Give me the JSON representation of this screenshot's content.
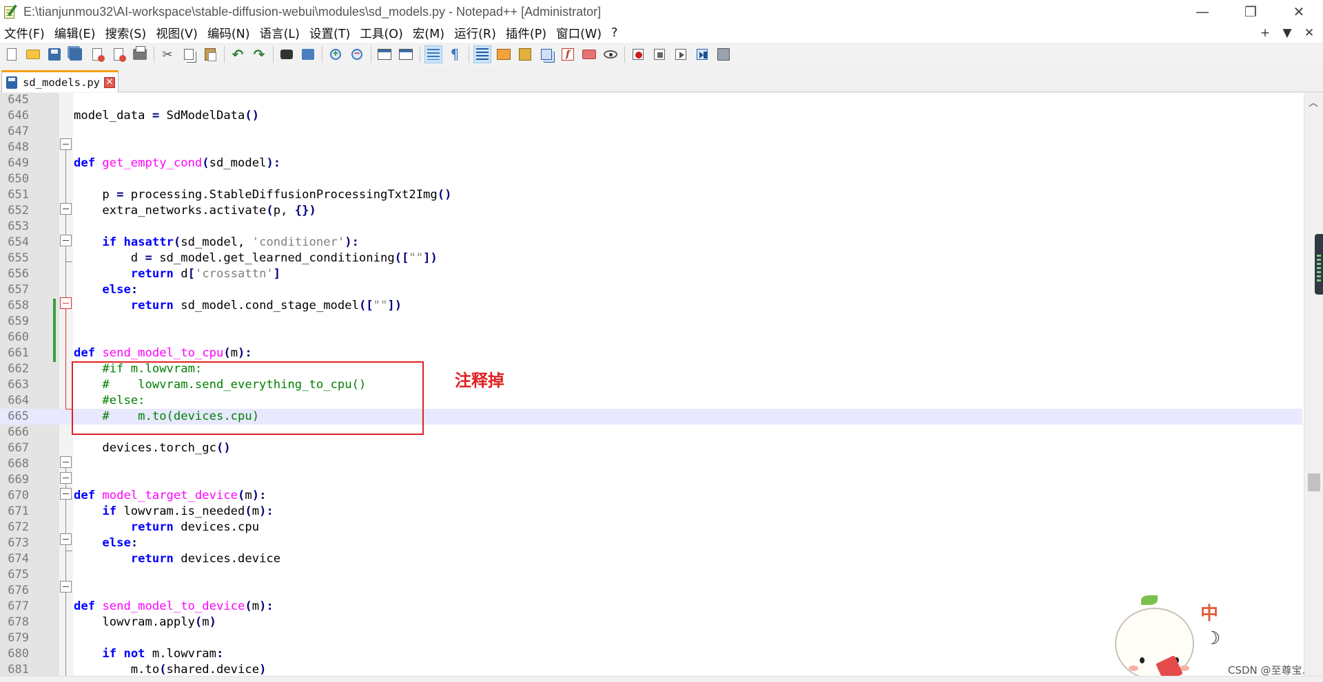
{
  "window": {
    "title": "E:\\tianjunmou32\\AI-workspace\\stable-diffusion-webui\\modules\\sd_models.py - Notepad++ [Administrator]",
    "controls": {
      "minimize": "—",
      "restore": "❐",
      "close": "✕"
    }
  },
  "menu": {
    "items": [
      "文件(F)",
      "编辑(E)",
      "搜索(S)",
      "视图(V)",
      "编码(N)",
      "语言(L)",
      "设置(T)",
      "工具(O)",
      "宏(M)",
      "运行(R)",
      "插件(P)",
      "窗口(W)",
      "?"
    ],
    "right": [
      "+",
      "▼",
      "✕"
    ]
  },
  "toolbar": {
    "icons": [
      "new-file-icon",
      "open-file-icon",
      "save-icon",
      "save-all-icon",
      "close-icon",
      "close-all-icon",
      "print-icon",
      "cut-icon",
      "copy-icon",
      "paste-icon",
      "undo-icon",
      "redo-icon",
      "find-icon",
      "replace-icon",
      "zoom-in-icon",
      "zoom-out-icon",
      "sync-vertical-icon",
      "sync-horizontal-icon",
      "word-wrap-icon",
      "show-all-chars-icon",
      "indent-guide-icon",
      "user-language-icon",
      "document-map-icon",
      "clone-view-icon",
      "function-list-icon",
      "folder-workspace-icon",
      "monitoring-icon",
      "record-macro-icon",
      "stop-record-icon",
      "play-macro-icon",
      "run-macro-multiple-icon",
      "save-macro-icon"
    ]
  },
  "tab": {
    "label": "sd_models.py",
    "close": "✕"
  },
  "editor": {
    "current_line": 665,
    "annotation": "注释掉",
    "lines": [
      {
        "n": "645",
        "code": ""
      },
      {
        "n": "646",
        "code": "model_data = SdModelData()"
      },
      {
        "n": "647",
        "code": ""
      },
      {
        "n": "648",
        "code": ""
      },
      {
        "n": "649",
        "code": "def get_empty_cond(sd_model):"
      },
      {
        "n": "650",
        "code": ""
      },
      {
        "n": "651",
        "code": "    p = processing.StableDiffusionProcessingTxt2Img()"
      },
      {
        "n": "652",
        "code": "    extra_networks.activate(p, {})"
      },
      {
        "n": "653",
        "code": ""
      },
      {
        "n": "654",
        "code": "    if hasattr(sd_model, 'conditioner'):"
      },
      {
        "n": "655",
        "code": "        d = sd_model.get_learned_conditioning([\"\"])"
      },
      {
        "n": "656",
        "code": "        return d['crossattn']"
      },
      {
        "n": "657",
        "code": "    else:"
      },
      {
        "n": "658",
        "code": "        return sd_model.cond_stage_model([\"\"])"
      },
      {
        "n": "659",
        "code": ""
      },
      {
        "n": "660",
        "code": ""
      },
      {
        "n": "661",
        "code": "def send_model_to_cpu(m):"
      },
      {
        "n": "662",
        "code": "    #if m.lowvram:"
      },
      {
        "n": "663",
        "code": "    #    lowvram.send_everything_to_cpu()"
      },
      {
        "n": "664",
        "code": "    #else:"
      },
      {
        "n": "665",
        "code": "    #    m.to(devices.cpu)"
      },
      {
        "n": "666",
        "code": ""
      },
      {
        "n": "667",
        "code": "    devices.torch_gc()"
      },
      {
        "n": "668",
        "code": ""
      },
      {
        "n": "669",
        "code": ""
      },
      {
        "n": "670",
        "code": "def model_target_device(m):"
      },
      {
        "n": "671",
        "code": "    if lowvram.is_needed(m):"
      },
      {
        "n": "672",
        "code": "        return devices.cpu"
      },
      {
        "n": "673",
        "code": "    else:"
      },
      {
        "n": "674",
        "code": "        return devices.device"
      },
      {
        "n": "675",
        "code": ""
      },
      {
        "n": "676",
        "code": ""
      },
      {
        "n": "677",
        "code": "def send_model_to_device(m):"
      },
      {
        "n": "678",
        "code": "    lowvram.apply(m)"
      },
      {
        "n": "679",
        "code": ""
      },
      {
        "n": "680",
        "code": "    if not m.lowvram:"
      },
      {
        "n": "681",
        "code": "        m.to(shared.device)"
      }
    ]
  },
  "mascot": {
    "char": "中",
    "symbol": "☽"
  },
  "watermark": "CSDN @至尊宝."
}
